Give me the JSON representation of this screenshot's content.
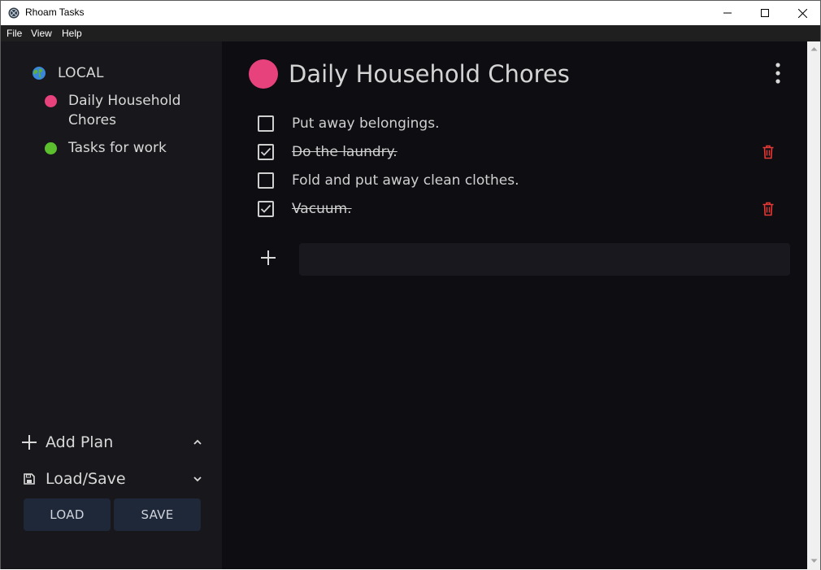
{
  "window": {
    "title": "Rhoam Tasks",
    "controls": [
      "minimize-icon",
      "maximize-icon",
      "close-icon"
    ]
  },
  "menu": {
    "items": [
      "File",
      "View",
      "Help"
    ]
  },
  "sidebar": {
    "root": {
      "label": "LOCAL",
      "icon": "globe-icon"
    },
    "plans": [
      {
        "label": "Daily Household Chores",
        "color": "#e8427c"
      },
      {
        "label": "Tasks for work",
        "color": "#5bbf2e"
      }
    ],
    "add_plan": {
      "label": "Add Plan",
      "icon": "plus-icon",
      "chevron": "chevron-up-icon"
    },
    "load_save": {
      "label": "Load/Save",
      "icon": "floppy-disk-icon",
      "chevron": "chevron-down-icon"
    },
    "buttons": {
      "load": "LOAD",
      "save": "SAVE"
    }
  },
  "main": {
    "title": "Daily Household Chores",
    "title_color": "#e8427c",
    "menu_icon": "more-vertical-icon",
    "tasks": [
      {
        "text": "Put away belongings.",
        "done": false
      },
      {
        "text": "Do the laundry.",
        "done": true
      },
      {
        "text": "Fold and put away clean clothes.",
        "done": false
      },
      {
        "text": "Vacuum.",
        "done": true
      }
    ],
    "new_task": {
      "value": "",
      "placeholder": "",
      "icon": "plus-icon"
    },
    "delete_icon": "trash-icon",
    "delete_color": "#e53935"
  }
}
